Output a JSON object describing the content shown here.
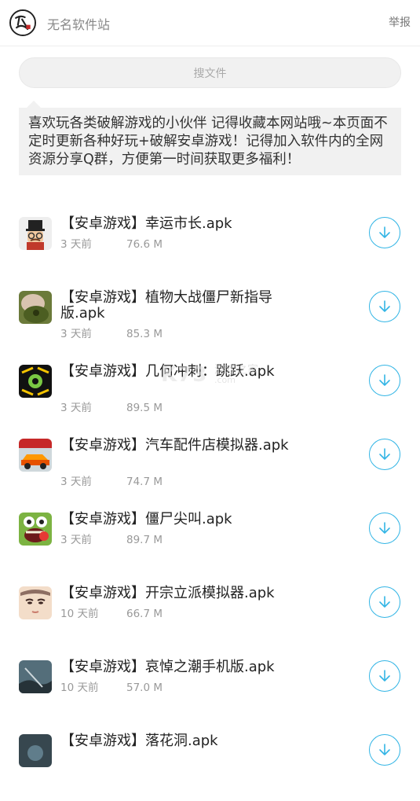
{
  "header": {
    "site_name": "无名软件站",
    "report_label": "举报",
    "logo_text": "无名"
  },
  "search": {
    "placeholder": "搜文件"
  },
  "notice": {
    "text": "喜欢玩各类破解游戏的小伙伴 记得收藏本网站哦~本页面不定时更新各种好玩+破解安卓游戏！记得加入软件内的全网资源分享Q群，方便第一时间获取更多福利！"
  },
  "watermark": {
    "brand": "K73",
    "text": "游戏之家",
    "url": ".com"
  },
  "files": [
    {
      "title": "【安卓游戏】幸运市长.apk",
      "age": "3 天前",
      "size": "76.6 M",
      "icon": "mayor-game-icon"
    },
    {
      "title": "【安卓游戏】植物大战僵尸新指导版.apk",
      "age": "3 天前",
      "size": "85.3 M",
      "icon": "plants-zombies-game-icon"
    },
    {
      "title": "【安卓游戏】几何冲刺：跳跃.apk",
      "age": "3 天前",
      "size": "89.5 M",
      "icon": "geometry-game-icon"
    },
    {
      "title": "【安卓游戏】汽车配件店模拟器.apk",
      "age": "3 天前",
      "size": "74.7 M",
      "icon": "car-parts-game-icon"
    },
    {
      "title": "【安卓游戏】僵尸尖叫.apk",
      "age": "3 天前",
      "size": "89.7 M",
      "icon": "zombie-scream-game-icon"
    },
    {
      "title": "【安卓游戏】开宗立派模拟器.apk",
      "age": "10 天前",
      "size": "66.7 M",
      "icon": "sect-simulator-game-icon"
    },
    {
      "title": "【安卓游戏】哀悼之潮手机版.apk",
      "age": "10 天前",
      "size": "57.0 M",
      "icon": "mourning-tide-game-icon"
    },
    {
      "title": "【安卓游戏】落花洞.apk",
      "age": "",
      "size": "",
      "icon": "falling-flower-cave-game-icon"
    }
  ],
  "colors": {
    "accent": "#33b5e5",
    "muted_text": "#999999",
    "notice_bg": "#f1f1f1"
  }
}
